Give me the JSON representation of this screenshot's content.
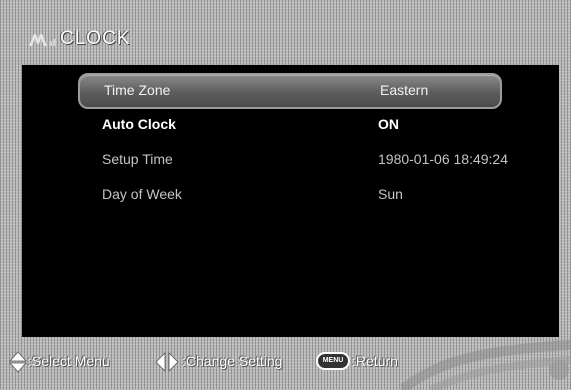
{
  "header": {
    "title": "CLOCK",
    "logo_icon": "clock-logo-icon"
  },
  "menu": {
    "items": [
      {
        "label": "Time Zone",
        "value": "Eastern",
        "selected": true
      },
      {
        "label": "Auto Clock",
        "value": "ON",
        "selected": false
      },
      {
        "label": "Setup Time",
        "value": "1980-01-06 18:49:24",
        "selected": false
      },
      {
        "label": "Day of Week",
        "value": "Sun",
        "selected": false
      }
    ]
  },
  "footer": {
    "select_icon": "up-down-arrows-icon",
    "select_label": ":Select Menu",
    "change_icon": "left-right-arrows-icon",
    "change_label": ":Change Setting",
    "menu_button_text": "MENU",
    "return_label": ":Return"
  },
  "colors": {
    "panel_bg": "#000000",
    "selected_row": "#5d5d5d",
    "text": "#ffffff"
  }
}
